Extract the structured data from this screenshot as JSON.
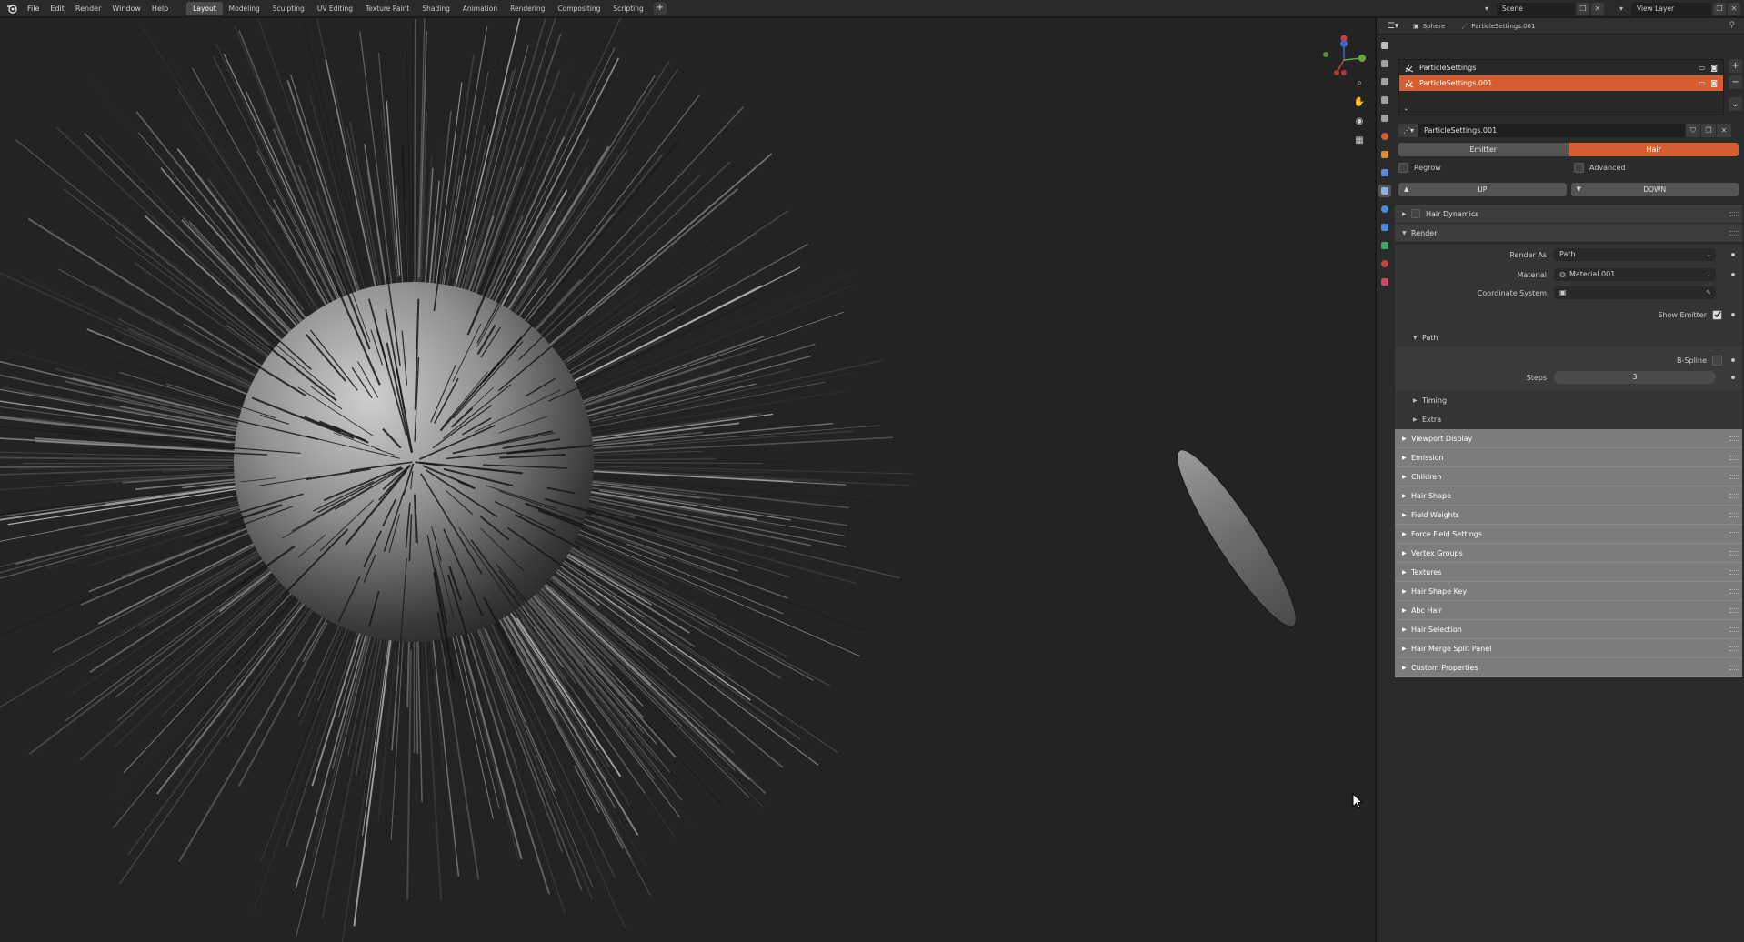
{
  "menu": [
    "File",
    "Edit",
    "Render",
    "Window",
    "Help"
  ],
  "workspaces": [
    "Layout",
    "Modeling",
    "Sculpting",
    "UV Editing",
    "Texture Paint",
    "Shading",
    "Animation",
    "Rendering",
    "Compositing",
    "Scripting"
  ],
  "active_workspace": "Layout",
  "scene_name": "Scene",
  "view_layer_name": "View Layer",
  "breadcrumb": {
    "object": "Sphere",
    "particle_settings": "ParticleSettings.001"
  },
  "particle_systems": [
    {
      "name": "ParticleSettings"
    },
    {
      "name": "ParticleSettings.001"
    }
  ],
  "datablock_name": "ParticleSettings.001",
  "type_options": {
    "emitter": "Emitter",
    "hair": "Hair",
    "selected": "Hair"
  },
  "regrow_label": "Regrow",
  "advanced_label": "Advanced",
  "up_label": "UP",
  "down_label": "DOWN",
  "panels": {
    "hair_dynamics": "Hair Dynamics",
    "render": "Render",
    "render_as_label": "Render As",
    "render_as_value": "Path",
    "material_label": "Material",
    "material_value": "Material.001",
    "coordinate_system_label": "Coordinate System",
    "show_emitter_label": "Show Emitter",
    "path": "Path",
    "bspline_label": "B-Spline",
    "steps_label": "Steps",
    "steps_value": "3",
    "timing": "Timing",
    "extra": "Extra"
  },
  "collapsed_panels": [
    "Viewport Display",
    "Emission",
    "Children",
    "Hair Shape",
    "Field Weights",
    "Force Field Settings",
    "Vertex Groups",
    "Textures",
    "Hair Shape Key",
    "Abc Hair",
    "Hair Selection",
    "Hair Merge Split Panel",
    "Custom Properties"
  ],
  "colors": {
    "accent": "#d55d30",
    "viewport_bg": "#232323",
    "panel_bg": "#2b2b2b"
  },
  "checkbox_state": {
    "regrow": false,
    "advanced": false,
    "hair_dynamics": false,
    "show_emitter": true,
    "bspline": false
  }
}
